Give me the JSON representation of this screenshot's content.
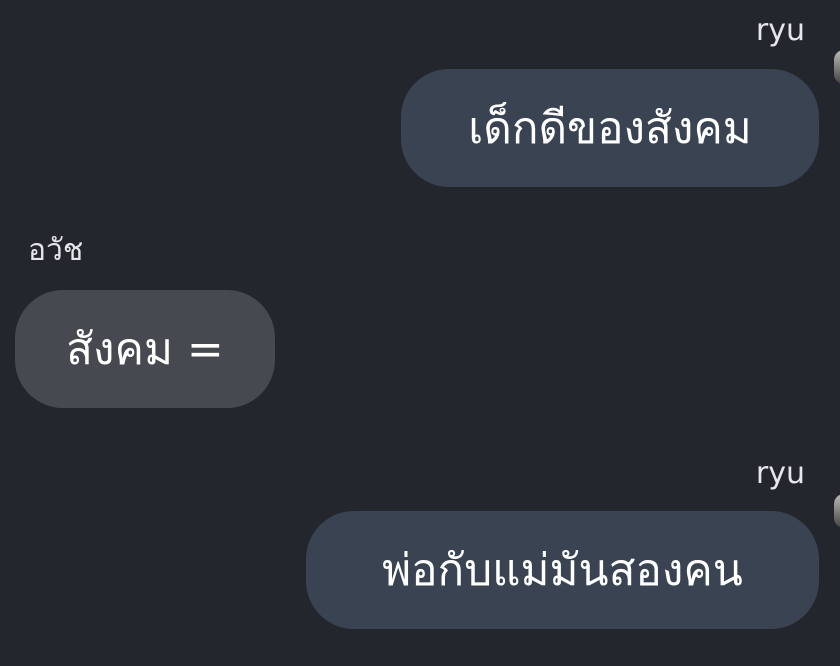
{
  "messages": [
    {
      "sender": "ryu",
      "text": "เด็กดีของสังคม",
      "direction": "outgoing"
    },
    {
      "sender": "อวัช",
      "text": "สังคม =",
      "direction": "incoming"
    },
    {
      "sender": "ryu",
      "text": "พ่อกับแม่มันสองคน",
      "direction": "outgoing"
    }
  ],
  "colors": {
    "background": "#23262d",
    "outgoing_bubble": "#3a4352",
    "incoming_bubble": "#464950",
    "text": "#ffffff"
  }
}
